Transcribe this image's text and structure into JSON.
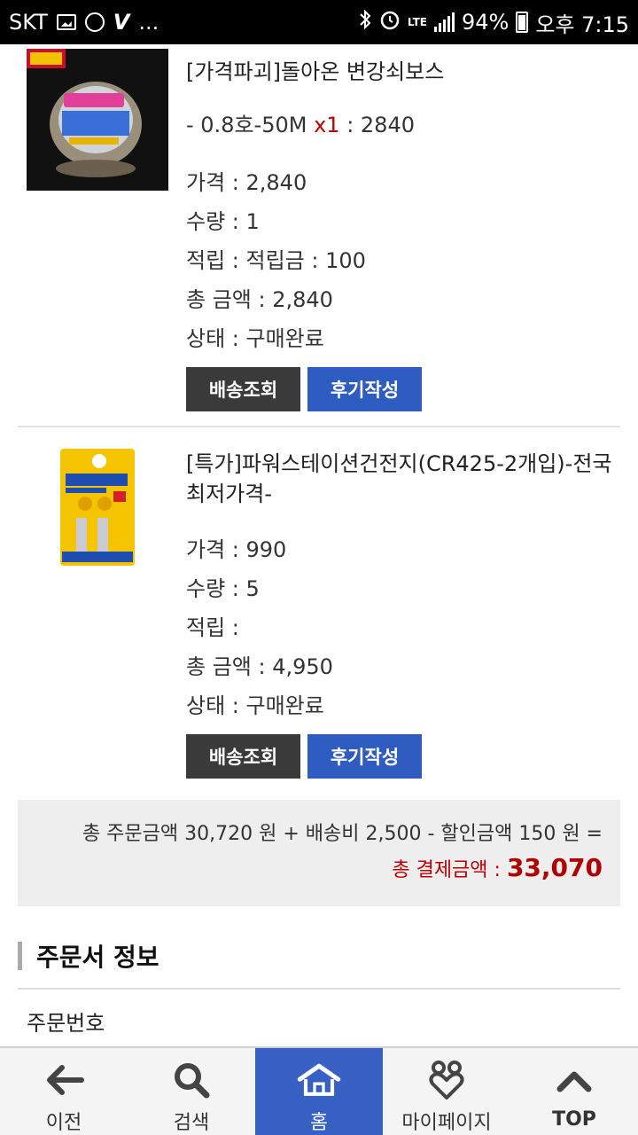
{
  "status_bar": {
    "carrier": "SKT",
    "dots": "...",
    "network": "LTE",
    "battery": "94%",
    "time": "오후 7:15"
  },
  "items": [
    {
      "title": "[가격파괴]돌아온 변강쇠보스",
      "option_prefix": "- 0.8호-50M ",
      "option_qty": "x1",
      "option_suffix": " : 2840",
      "price": "가격 : 2,840",
      "quantity": "수량 : 1",
      "points": "적립 : 적립금 : 100",
      "total": "총 금액 : 2,840",
      "status": "상태 : 구매완료",
      "btn_track": "배송조회",
      "btn_review": "후기작성"
    },
    {
      "title": "[특가]파워스테이션건전지(CR425-2개입)-전국최저가격-",
      "price": "가격 : 990",
      "quantity": "수량 : 5",
      "points": "적립 :",
      "total": "총 금액 : 4,950",
      "status": "상태 : 구매완료",
      "btn_track": "배송조회",
      "btn_review": "후기작성"
    }
  ],
  "summary": {
    "line": "총 주문금액 30,720 원 + 배송비 2,500 - 할인금액 150 원 =",
    "total_label": "총 결제금액 : ",
    "total_amount": "33,070"
  },
  "order_info": {
    "section_title": "주문서 정보",
    "order_number_label": "주문번호"
  },
  "bottom_nav": {
    "back": "이전",
    "search": "검색",
    "home": "홈",
    "mypage": "마이페이지",
    "top": "TOP"
  },
  "colors": {
    "accent": "#2f5cc0",
    "nav_active": "#3660c4",
    "price_red": "#c00000"
  }
}
